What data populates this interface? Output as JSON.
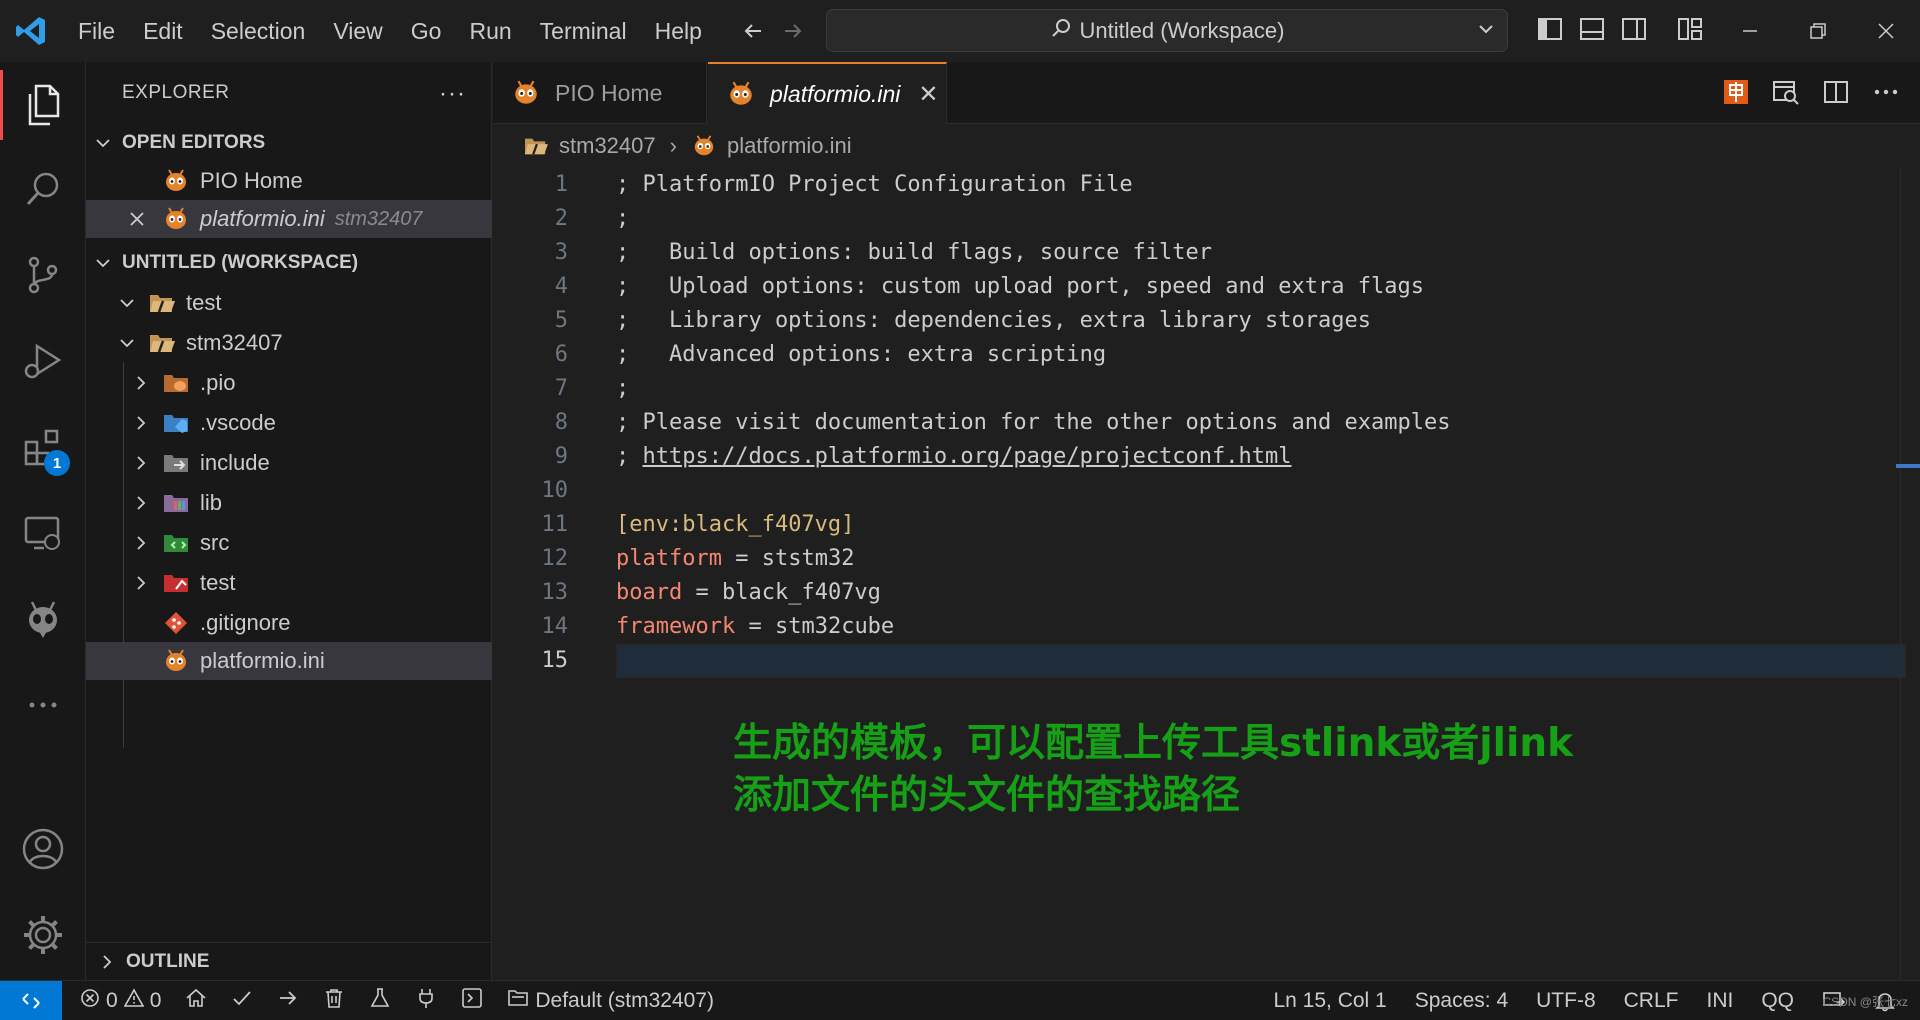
{
  "menu": [
    "File",
    "Edit",
    "Selection",
    "View",
    "Go",
    "Run",
    "Terminal",
    "Help"
  ],
  "command_center": {
    "label": "Untitled (Workspace)"
  },
  "activity_bar": {
    "extensions_badge": "1"
  },
  "explorer": {
    "title": "EXPLORER",
    "more": "···",
    "open_editors": {
      "title": "OPEN EDITORS",
      "items": [
        {
          "label": "PIO Home",
          "desc": ""
        },
        {
          "label": "platformio.ini",
          "desc": "stm32407"
        }
      ]
    },
    "workspace": {
      "title": "UNTITLED (WORKSPACE)",
      "folders": [
        {
          "label": "test"
        },
        {
          "label": "stm32407"
        }
      ],
      "children": [
        ".pio",
        ".vscode",
        "include",
        "lib",
        "src",
        "test",
        ".gitignore",
        "platformio.ini"
      ]
    },
    "outline": "OUTLINE"
  },
  "tabs": [
    {
      "label": "PIO Home"
    },
    {
      "label": "platformio.ini",
      "close": "✕"
    }
  ],
  "breadcrumb": {
    "folder": "stm32407",
    "file": "platformio.ini",
    "sep": "›"
  },
  "editor": {
    "line_numbers": [
      "1",
      "2",
      "3",
      "4",
      "5",
      "6",
      "7",
      "8",
      "9",
      "10",
      "11",
      "12",
      "13",
      "14",
      "15"
    ],
    "lines": {
      "l1": "; PlatformIO Project Configuration File",
      "l2": ";",
      "l3": ";   Build options: build flags, source filter",
      "l4": ";   Upload options: custom upload port, speed and extra flags",
      "l5": ";   Library options: dependencies, extra library storages",
      "l6": ";   Advanced options: extra scripting",
      "l7": ";",
      "l8": "; Please visit documentation for the other options and examples",
      "l9_prefix": "; ",
      "l9_link": "https://docs.platformio.org/page/projectconf.html",
      "l11_open": "[",
      "l11_section": "env:black_f407vg",
      "l11_close": "]",
      "l12_key": "platform",
      "l12_val": "ststm32",
      "l13_key": "board",
      "l13_val": "black_f407vg",
      "l14_key": "framework",
      "l14_val": "stm32cube",
      "eq": " = "
    },
    "annotation": [
      "生成的模板，可以配置上传工具stlink或者jlink",
      "添加文件的头文件的查找路径"
    ]
  },
  "statusbar": {
    "errors": "0",
    "warnings": "0",
    "env": "Default (stm32407)",
    "position": "Ln 15, Col 1",
    "spaces": "Spaces: 4",
    "encoding": "UTF-8",
    "eol": "CRLF",
    "language": "INI",
    "qq": "QQ",
    "watermark": "CSDN @张七xz"
  },
  "colors": {
    "accent": "#0078d4",
    "annotation": "#16a016",
    "pio_orange": "#e5822b",
    "ini_key": "#f48771",
    "ini_section": "#d7ba7d"
  }
}
